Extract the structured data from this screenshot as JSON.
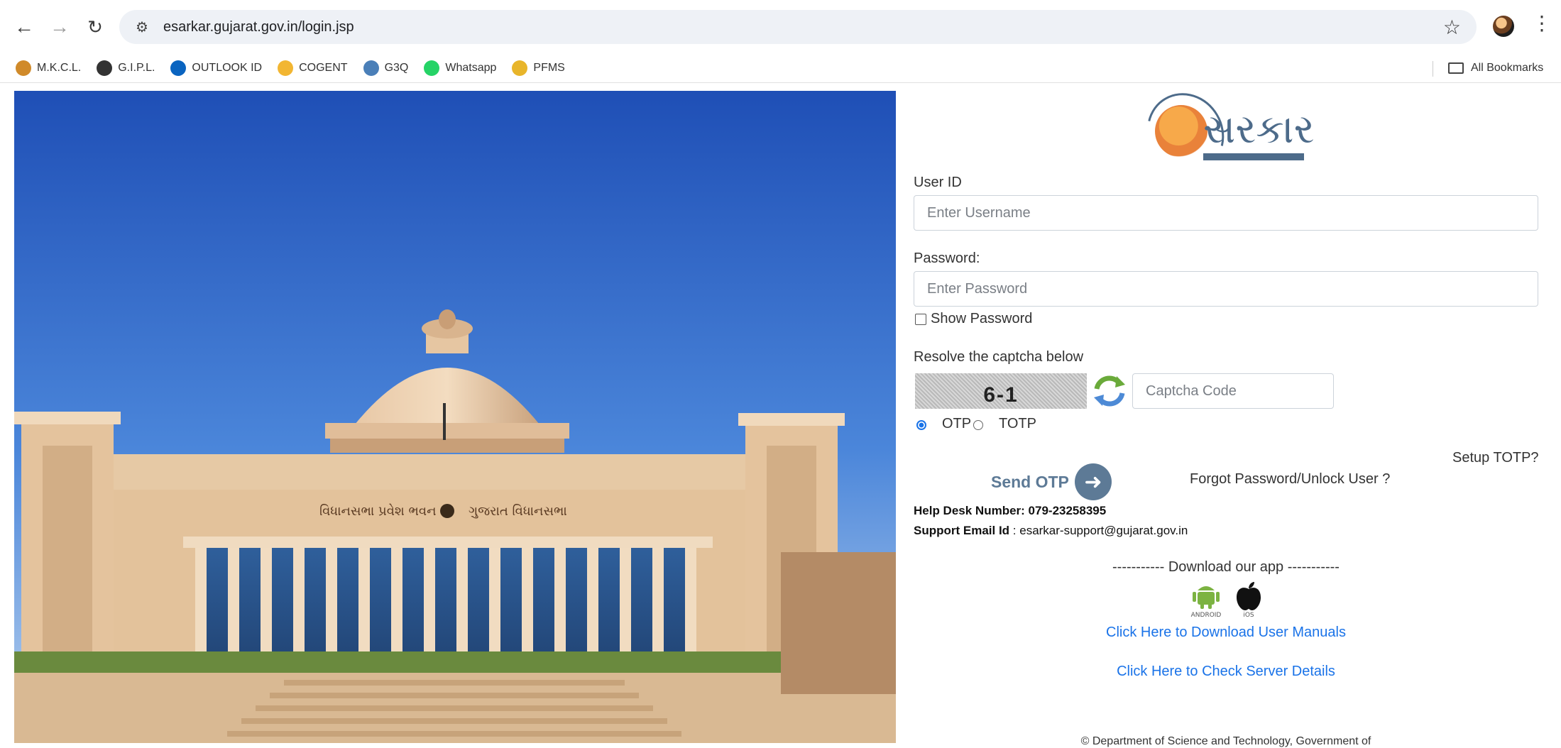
{
  "browser": {
    "url": "esarkar.gujarat.gov.in/login.jsp",
    "bookmarks": [
      {
        "label": "M.K.C.L.",
        "icon": "mkcl-icon",
        "color": "#d08a2a"
      },
      {
        "label": "G.I.P.L.",
        "icon": "globe-icon",
        "color": "#333333"
      },
      {
        "label": "OUTLOOK ID",
        "icon": "outlook-icon",
        "color": "#0a64c0"
      },
      {
        "label": "COGENT",
        "icon": "cogent-icon",
        "color": "#f2b632"
      },
      {
        "label": "G3Q",
        "icon": "g3q-icon",
        "color": "#4a7fb8"
      },
      {
        "label": "Whatsapp",
        "icon": "whatsapp-icon",
        "color": "#25d366"
      },
      {
        "label": "PFMS",
        "icon": "pfms-icon",
        "color": "#e8b52a"
      }
    ],
    "all_bookmarks": "All Bookmarks"
  },
  "logo": {
    "text": "સરકાર"
  },
  "form": {
    "user_id_label": "User ID",
    "user_id_placeholder": "Enter Username",
    "password_label": "Password:",
    "password_placeholder": "Enter Password",
    "show_password_label": "Show Password",
    "captcha_label": "Resolve the captcha below",
    "captcha_text": "6-1",
    "captcha_placeholder": "Captcha Code",
    "otp_label": "OTP",
    "totp_label": "TOTP",
    "otp_selected": true,
    "setup_totp": "Setup TOTP?",
    "send_otp": "Send OTP",
    "forgot_password": "Forgot Password/Unlock User ?"
  },
  "help": {
    "helpdesk_label": "Help Desk Number: 079-23258395",
    "email_label": "Support Email Id",
    "email_sep": " : ",
    "email": "esarkar-support@gujarat.gov.in"
  },
  "download": {
    "header": "----------- Download our app -----------",
    "android_label": "ANDROID",
    "ios_label": "iOS",
    "manuals_link": "Click Here to Download User Manuals",
    "server_link": "Click Here to Check Server Details"
  },
  "footer": "© Department of Science and Technology, Government of",
  "hero": {
    "banner_left": "વિધાનસભા પ્રવેશ ભવન",
    "banner_right": "ગુજરાત વિધાનસભા"
  },
  "colors": {
    "accent": "#5d7a96",
    "link": "#1a73e8",
    "logo": "#4d6b8a"
  }
}
